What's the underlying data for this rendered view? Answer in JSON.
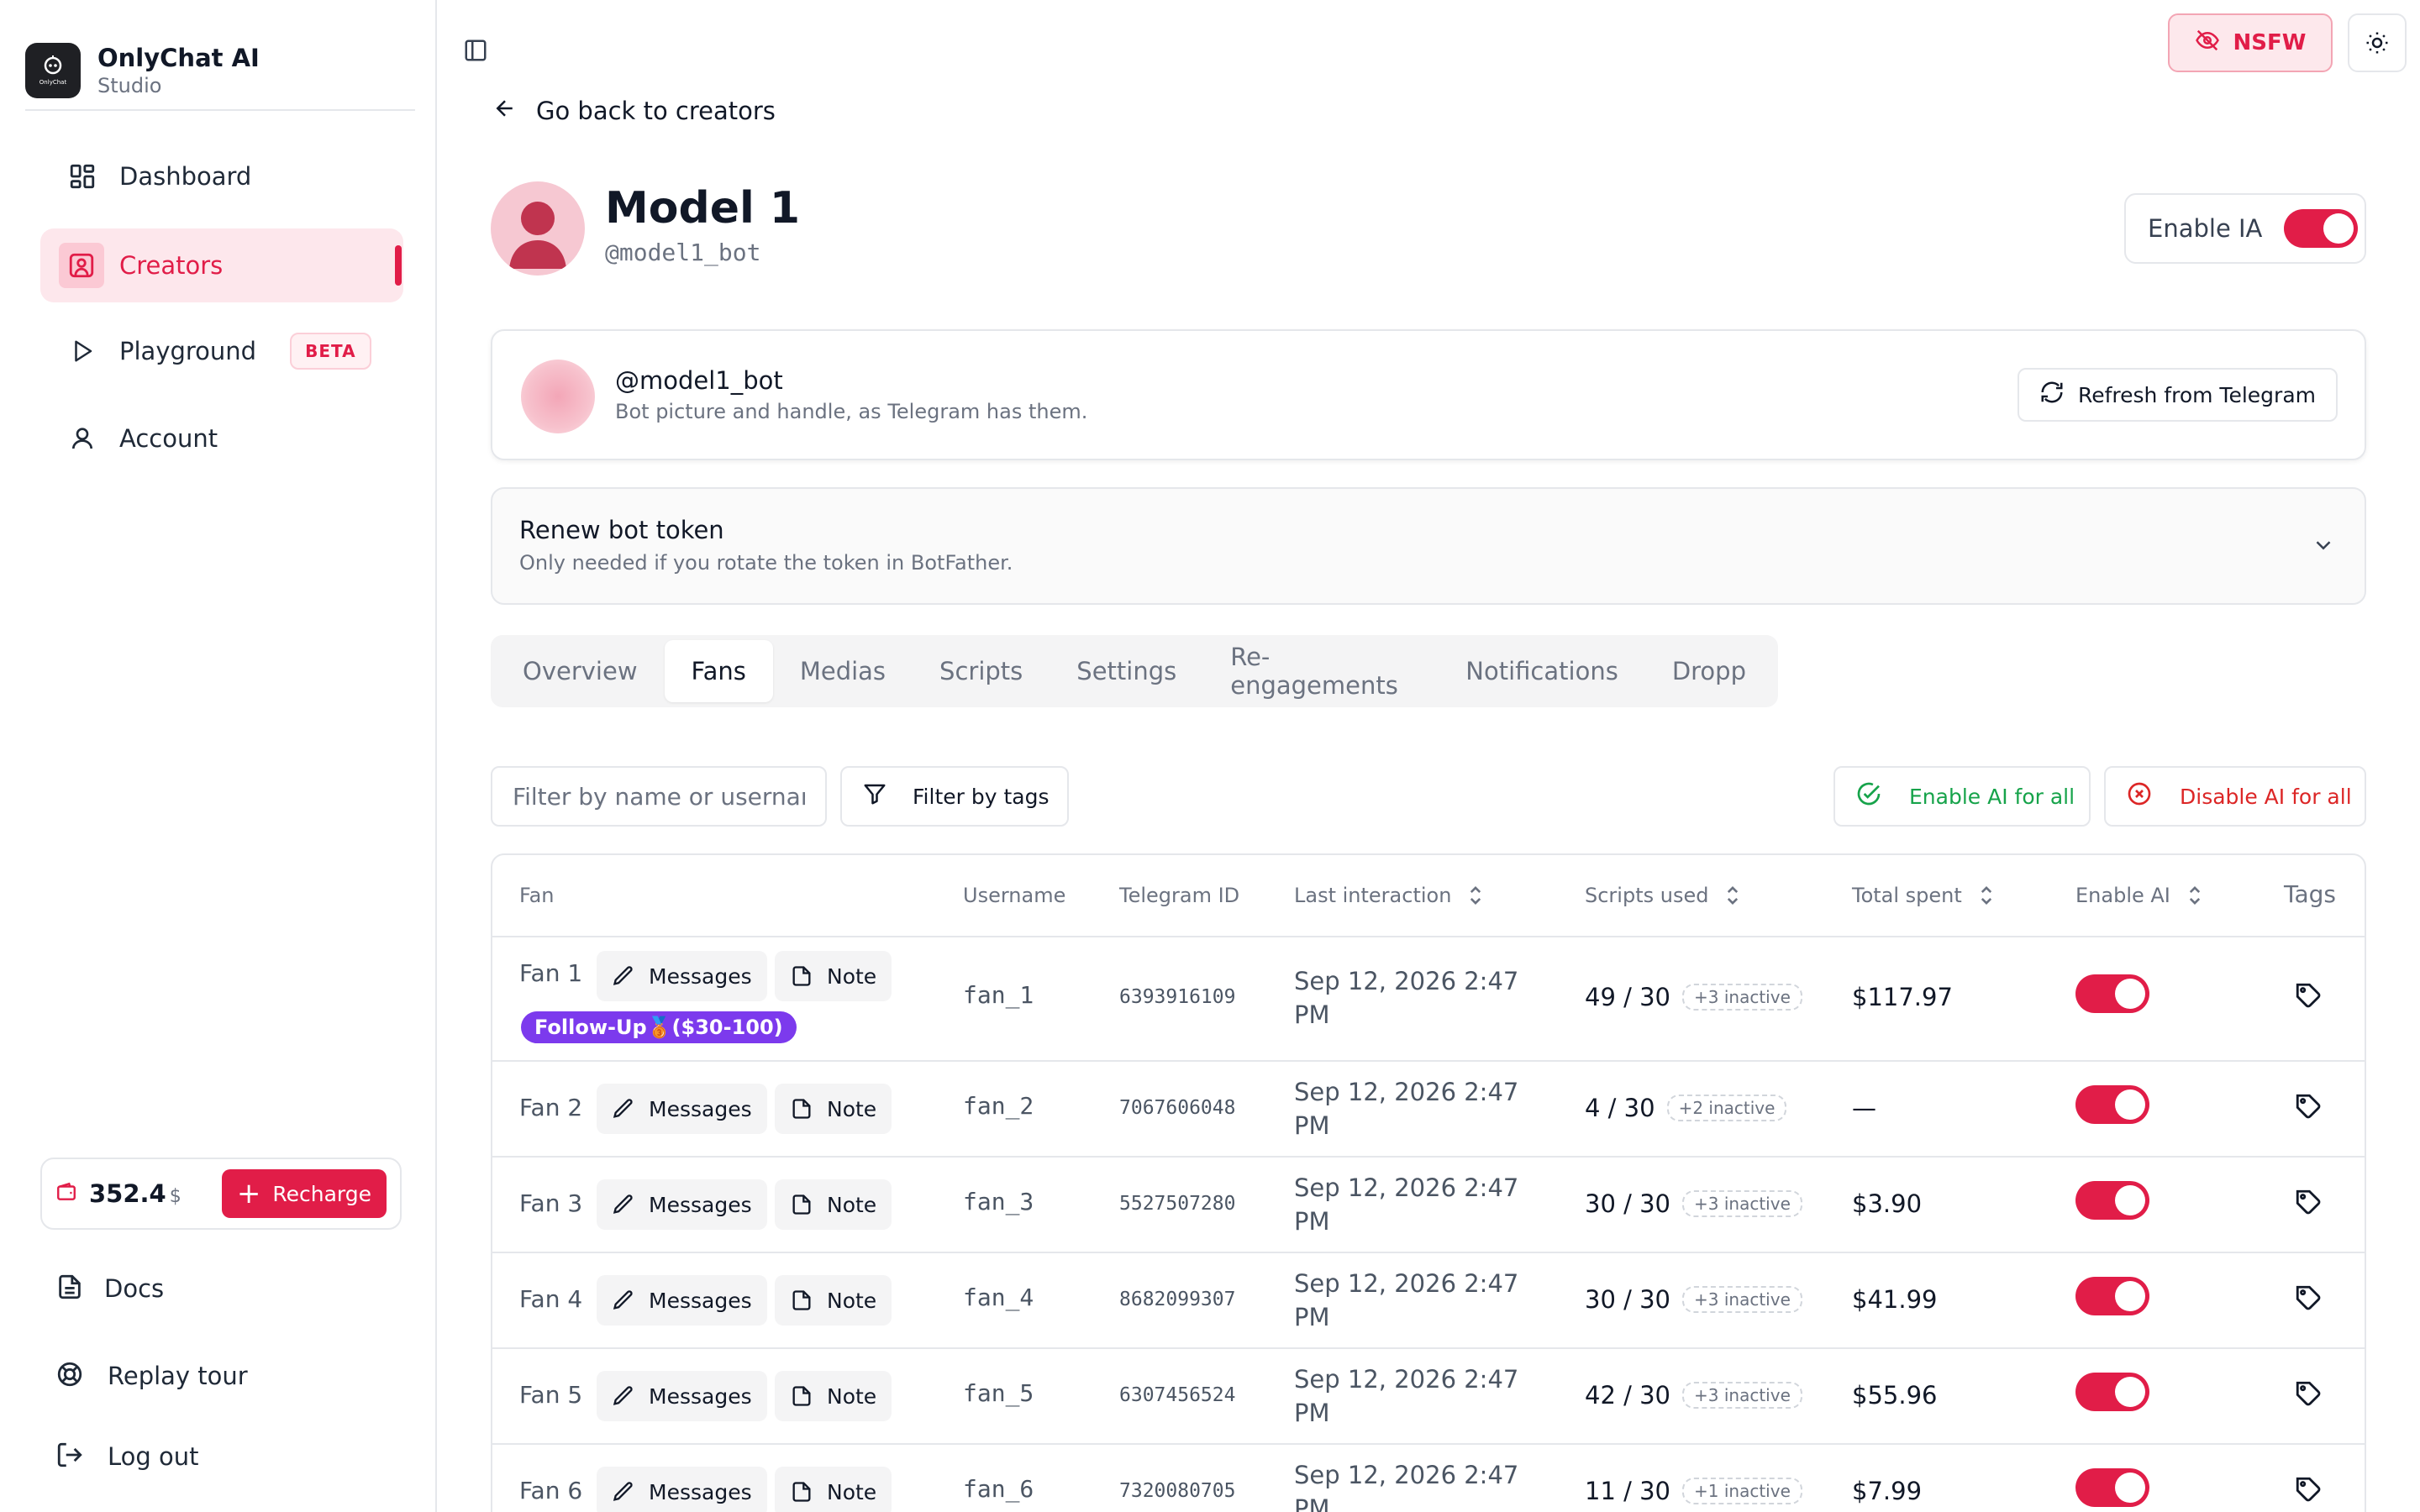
{
  "brand": {
    "name": "OnlyChat AI",
    "subtitle": "Studio",
    "logo_text": "OnlyChat"
  },
  "sidebar": {
    "items": [
      {
        "label": "Dashboard",
        "icon": "dashboard-icon"
      },
      {
        "label": "Creators",
        "icon": "user-square-icon",
        "active": true
      },
      {
        "label": "Playground",
        "icon": "play-icon",
        "badge": "BETA"
      },
      {
        "label": "Account",
        "icon": "user-icon"
      }
    ],
    "balance": {
      "amount": "352.4",
      "currency": "$",
      "recharge_label": "Recharge"
    },
    "footer": [
      {
        "label": "Docs",
        "icon": "document-icon"
      },
      {
        "label": "Replay tour",
        "icon": "lifebuoy-icon"
      },
      {
        "label": "Log out",
        "icon": "logout-icon"
      }
    ]
  },
  "topbar": {
    "nsfw_label": "NSFW"
  },
  "back_label": "Go back to creators",
  "model": {
    "name": "Model 1",
    "handle": "@model1_bot",
    "enable_label": "Enable IA",
    "enabled": true
  },
  "bot_card": {
    "handle": "@model1_bot",
    "description": "Bot picture and handle, as Telegram has them.",
    "refresh_label": "Refresh from Telegram"
  },
  "renew": {
    "title": "Renew bot token",
    "description": "Only needed if you rotate the token in BotFather."
  },
  "tabs": [
    "Overview",
    "Fans",
    "Medias",
    "Scripts",
    "Settings",
    "Re-engagements",
    "Notifications",
    "Dropp"
  ],
  "active_tab": "Fans",
  "filters": {
    "search_placeholder": "Filter by name or username",
    "tags_label": "Filter by tags",
    "enable_all_label": "Enable AI for all",
    "disable_all_label": "Disable AI for all"
  },
  "table": {
    "headers": {
      "fan": "Fan",
      "username": "Username",
      "telegram_id": "Telegram ID",
      "last_interaction": "Last interaction",
      "scripts_used": "Scripts used",
      "total_spent": "Total spent",
      "enable_ai": "Enable AI",
      "tags": "Tags"
    },
    "chip_messages": "Messages",
    "chip_note": "Note",
    "rows": [
      {
        "fan": "Fan 1",
        "username": "fan_1",
        "telegram_id": "6393916109",
        "last_1": "Sep 12, 2026 2:47",
        "last_2": "PM",
        "scripts": "49 / 30",
        "inactive": "+3 inactive",
        "spent": "$117.97",
        "enabled": true,
        "badge": "Follow-Up🥉($30-100)"
      },
      {
        "fan": "Fan 2",
        "username": "fan_2",
        "telegram_id": "7067606048",
        "last_1": "Sep 12, 2026 2:47",
        "last_2": "PM",
        "scripts": "4 / 30",
        "inactive": "+2 inactive",
        "spent": "—",
        "enabled": true
      },
      {
        "fan": "Fan 3",
        "username": "fan_3",
        "telegram_id": "5527507280",
        "last_1": "Sep 12, 2026 2:47",
        "last_2": "PM",
        "scripts": "30 / 30",
        "inactive": "+3 inactive",
        "spent": "$3.90",
        "enabled": true
      },
      {
        "fan": "Fan 4",
        "username": "fan_4",
        "telegram_id": "8682099307",
        "last_1": "Sep 12, 2026 2:47",
        "last_2": "PM",
        "scripts": "30 / 30",
        "inactive": "+3 inactive",
        "spent": "$41.99",
        "enabled": true
      },
      {
        "fan": "Fan 5",
        "username": "fan_5",
        "telegram_id": "6307456524",
        "last_1": "Sep 12, 2026 2:47",
        "last_2": "PM",
        "scripts": "42 / 30",
        "inactive": "+3 inactive",
        "spent": "$55.96",
        "enabled": true
      },
      {
        "fan": "Fan 6",
        "username": "fan_6",
        "telegram_id": "7320080705",
        "last_1": "Sep 12, 2026 2:47",
        "last_2": "PM",
        "scripts": "11 / 30",
        "inactive": "+1 inactive",
        "spent": "$7.99",
        "enabled": true
      }
    ]
  },
  "colors": {
    "accent": "#e11d48",
    "success": "#16a34a",
    "danger": "#dc2626",
    "badge_purple": "#7c3aed"
  }
}
